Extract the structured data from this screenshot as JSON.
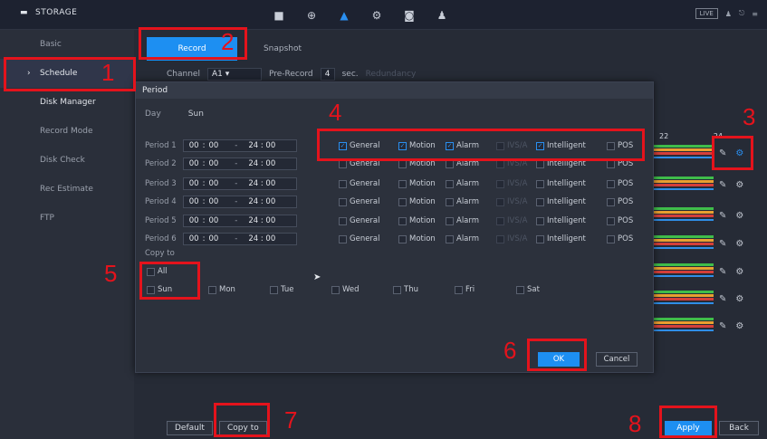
{
  "topbar": {
    "section_title": "STORAGE",
    "live_label": "LIVE",
    "icons": [
      "camera-icon",
      "network-icon",
      "storage-icon",
      "system-icon",
      "security-icon",
      "account-icon"
    ]
  },
  "sidebar": {
    "items": [
      {
        "label": "Basic"
      },
      {
        "label": "Schedule"
      },
      {
        "label": "Disk Manager"
      },
      {
        "label": "Record Mode"
      },
      {
        "label": "Disk Check"
      },
      {
        "label": "Rec Estimate"
      },
      {
        "label": "FTP"
      }
    ]
  },
  "tabs": [
    "Record",
    "Snapshot"
  ],
  "channel": {
    "label": "Channel",
    "value": "A1",
    "prerecord_label": "Pre-Record",
    "prerecord_value": "4",
    "prerecord_unit": "sec.",
    "redundancy_label": "Redundancy"
  },
  "schedule_hours": [
    "22",
    "24"
  ],
  "dialog": {
    "title": "Period",
    "day_label": "Day",
    "day_value": "Sun",
    "periods": [
      {
        "label": "Period 1",
        "start_h": "00",
        "start_m": "00",
        "end": "24 : 00"
      },
      {
        "label": "Period 2",
        "start_h": "00",
        "start_m": "00",
        "end": "24 : 00"
      },
      {
        "label": "Period 3",
        "start_h": "00",
        "start_m": "00",
        "end": "24 : 00"
      },
      {
        "label": "Period 4",
        "start_h": "00",
        "start_m": "00",
        "end": "24 : 00"
      },
      {
        "label": "Period 5",
        "start_h": "00",
        "start_m": "00",
        "end": "24 : 00"
      },
      {
        "label": "Period 6",
        "start_h": "00",
        "start_m": "00",
        "end": "24 : 00"
      }
    ],
    "check_labels": {
      "general": "General",
      "motion": "Motion",
      "alarm": "Alarm",
      "ivs": "IVS/A",
      "intelligent": "Intelligent",
      "pos": "POS"
    },
    "copy_to_label": "Copy to",
    "copy_all": "All",
    "copy_days": [
      "Sun",
      "Mon",
      "Tue",
      "Wed",
      "Thu",
      "Fri",
      "Sat"
    ],
    "ok_label": "OK",
    "cancel_label": "Cancel"
  },
  "bottom": {
    "default_label": "Default",
    "copy_to_label": "Copy to",
    "apply_label": "Apply",
    "back_label": "Back"
  },
  "annotations": [
    "1",
    "2",
    "3",
    "4",
    "5",
    "6",
    "7",
    "8"
  ]
}
